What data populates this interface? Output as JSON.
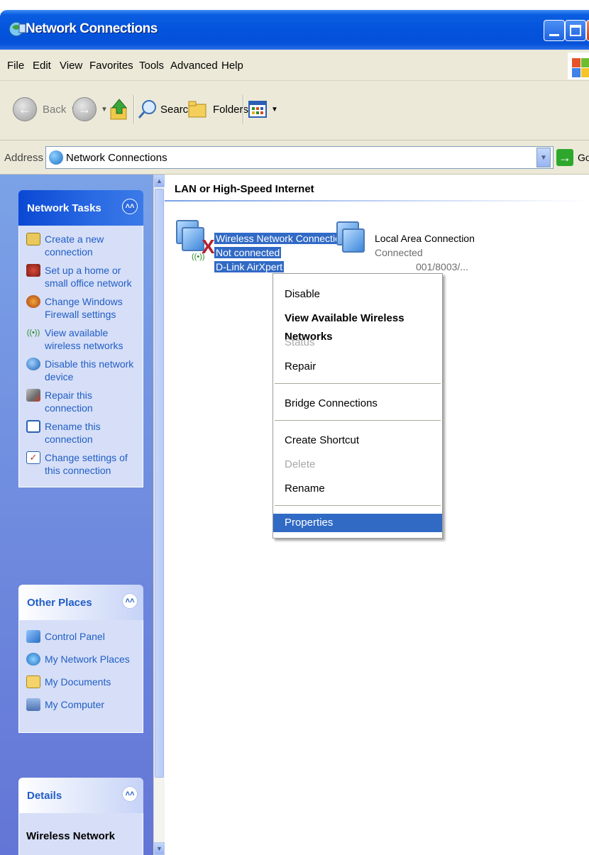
{
  "window": {
    "title": "Network Connections"
  },
  "menubar": {
    "items": [
      "File",
      "Edit",
      "View",
      "Favorites",
      "Tools",
      "Advanced",
      "Help"
    ]
  },
  "toolbar": {
    "back": "Back",
    "search": "Search",
    "folders": "Folders"
  },
  "address": {
    "label": "Address",
    "value": "Network Connections",
    "go": "Go"
  },
  "taskpane": {
    "network_tasks": {
      "title": "Network Tasks",
      "items": [
        "Create a new connection",
        "Set up a home or small office network",
        "Change Windows Firewall settings",
        "View available wireless networks",
        "Disable this network device",
        "Repair this connection",
        "Rename this connection",
        "Change settings of this connection"
      ]
    },
    "other_places": {
      "title": "Other Places",
      "items": [
        "Control Panel",
        "My Network Places",
        "My Documents",
        "My Computer"
      ]
    },
    "details": {
      "title": "Details",
      "heading": "Wireless Network"
    }
  },
  "content": {
    "group_title": "LAN or High-Speed Internet",
    "wireless": {
      "name": "Wireless Network Connection",
      "status": "Not connected",
      "device": "D-Link AirXpert"
    },
    "lan": {
      "name": "Local Area Connection",
      "status": "Connected",
      "device_partial": "001/8003/..."
    }
  },
  "context_menu": {
    "items": [
      "Disable",
      "View Available Wireless Networks",
      "Status",
      "Repair",
      "Bridge Connections",
      "Create Shortcut",
      "Delete",
      "Rename",
      "Properties"
    ]
  },
  "colors": {
    "selection": "#316ac5",
    "title_bar": "#0453dd",
    "link": "#215dc6"
  }
}
